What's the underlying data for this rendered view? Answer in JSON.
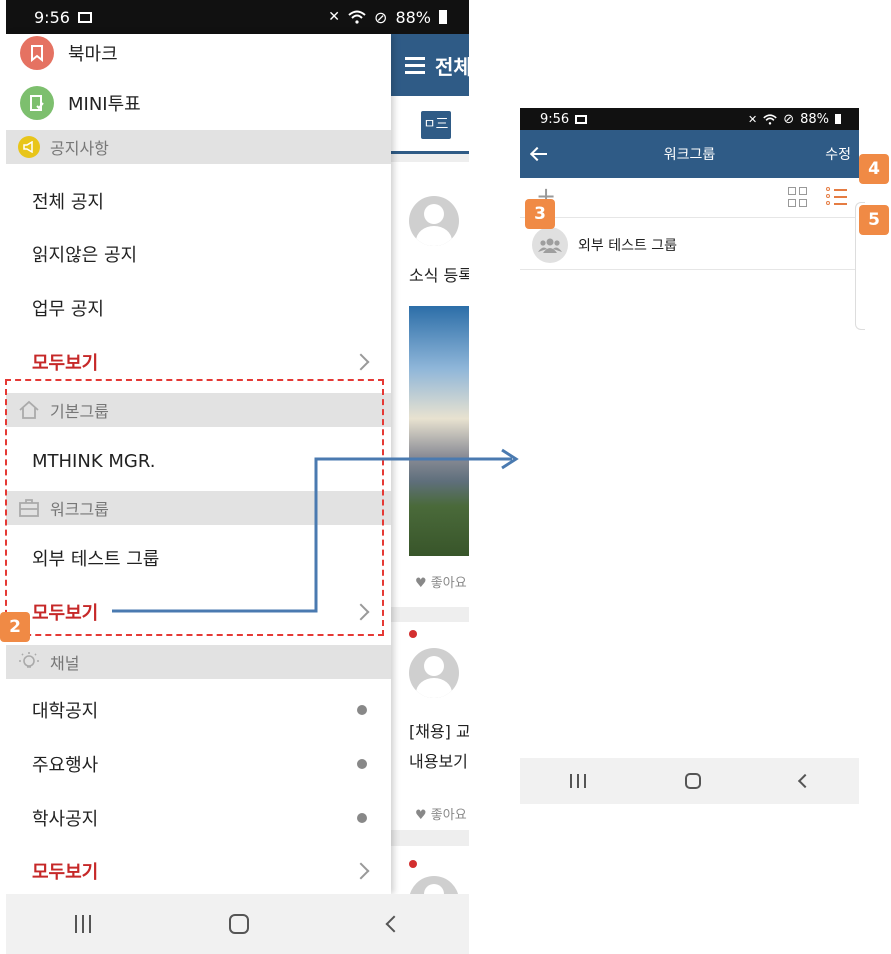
{
  "left": {
    "status": {
      "time": "9:56",
      "battery": "88%"
    },
    "feed": {
      "header_title": "전체",
      "tab_label": "ㅁ三",
      "post1_text": "소식 등록",
      "post1_like": "좋아요",
      "post2_text1": "[채용] 교",
      "post2_text2": "내용보기",
      "post2_like": "좋아요"
    },
    "drawer": {
      "bookmark": "북마크",
      "mini_vote": "MINI투표",
      "notice_header": "공지사항",
      "all_notice": "전체 공지",
      "unread_notice": "읽지않은 공지",
      "work_notice": "업무 공지",
      "view_all_1": "모두보기",
      "basic_group_header": "기본그룹",
      "mthink": "MTHINK MGR.",
      "work_group_header": "워크그룹",
      "external_test": "외부 테스트 그룹",
      "view_all_2": "모두보기",
      "channel_header": "채널",
      "univ_notice": "대학공지",
      "major_events": "주요행사",
      "academic_notice": "학사공지",
      "view_all_3": "모두보기"
    }
  },
  "right": {
    "status": {
      "time": "9:56",
      "battery": "88%"
    },
    "header": {
      "title": "워크그룹",
      "edit": "수정"
    },
    "toolbar": {
      "plus": "+"
    },
    "group_name": "외부 테스트 그룹"
  },
  "badges": {
    "b2": "2",
    "b3": "3",
    "b4": "4",
    "b5": "5"
  },
  "colors": {
    "header_blue": "#2f5b86",
    "accent_red": "#c62828",
    "badge_orange": "#f08a45",
    "annotation_red": "#e53935"
  }
}
